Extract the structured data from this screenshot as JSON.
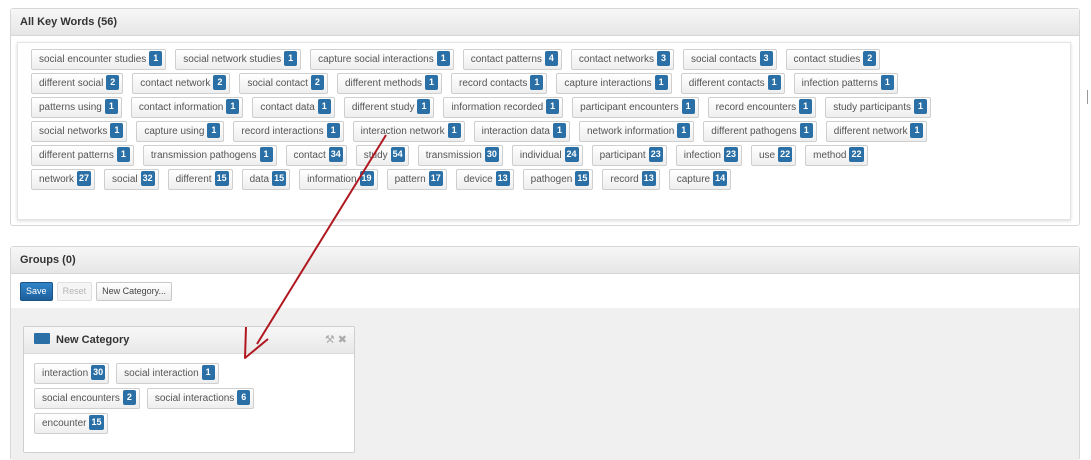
{
  "keywords_panel": {
    "title": "All Key Words (56)",
    "rows": [
      [
        {
          "label": "social encounter studies",
          "count": "1"
        },
        {
          "label": "social network studies",
          "count": "1"
        },
        {
          "label": "capture social interactions",
          "count": "1"
        },
        {
          "label": "contact patterns",
          "count": "4"
        },
        {
          "label": "contact networks",
          "count": "3"
        },
        {
          "label": "social contacts",
          "count": "3"
        },
        {
          "label": "contact studies",
          "count": "2"
        }
      ],
      [
        {
          "label": "different social",
          "count": "2"
        },
        {
          "label": "contact network",
          "count": "2"
        },
        {
          "label": "social contact",
          "count": "2"
        },
        {
          "label": "different methods",
          "count": "1"
        },
        {
          "label": "record contacts",
          "count": "1"
        },
        {
          "label": "capture interactions",
          "count": "1"
        },
        {
          "label": "different contacts",
          "count": "1"
        },
        {
          "label": "infection patterns",
          "count": "1"
        }
      ],
      [
        {
          "label": "patterns using",
          "count": "1"
        },
        {
          "label": "contact information",
          "count": "1"
        },
        {
          "label": "contact data",
          "count": "1"
        },
        {
          "label": "different study",
          "count": "1"
        },
        {
          "label": "information recorded",
          "count": "1"
        },
        {
          "label": "participant encounters",
          "count": "1"
        },
        {
          "label": "record encounters",
          "count": "1"
        },
        {
          "label": "study participants",
          "count": "1"
        }
      ],
      [
        {
          "label": "social networks",
          "count": "1"
        },
        {
          "label": "capture using",
          "count": "1"
        },
        {
          "label": "record interactions",
          "count": "1"
        },
        {
          "label": "interaction network",
          "count": "1"
        },
        {
          "label": "interaction data",
          "count": "1"
        },
        {
          "label": "network information",
          "count": "1"
        },
        {
          "label": "different pathogens",
          "count": "1"
        },
        {
          "label": "different network",
          "count": "1"
        }
      ],
      [
        {
          "label": "different patterns",
          "count": "1"
        },
        {
          "label": "transmission pathogens",
          "count": "1"
        },
        {
          "label": "contact",
          "count": "34"
        },
        {
          "label": "study",
          "count": "54"
        },
        {
          "label": "transmission",
          "count": "30"
        },
        {
          "label": "individual",
          "count": "24"
        },
        {
          "label": "participant",
          "count": "23"
        },
        {
          "label": "infection",
          "count": "23"
        },
        {
          "label": "use",
          "count": "22"
        },
        {
          "label": "method",
          "count": "22"
        }
      ],
      [
        {
          "label": "network",
          "count": "27"
        },
        {
          "label": "social",
          "count": "32"
        },
        {
          "label": "different",
          "count": "15"
        },
        {
          "label": "data",
          "count": "15"
        },
        {
          "label": "information",
          "count": "19"
        },
        {
          "label": "pattern",
          "count": "17"
        },
        {
          "label": "device",
          "count": "13"
        },
        {
          "label": "pathogen",
          "count": "15"
        },
        {
          "label": "record",
          "count": "13"
        },
        {
          "label": "capture",
          "count": "14"
        }
      ]
    ]
  },
  "groups_panel": {
    "title": "Groups (0)",
    "toolbar": {
      "save_label": "Save",
      "reset_label": "Reset",
      "new_category_label": "New Category..."
    },
    "category": {
      "title": "New Category",
      "tool_icons": [
        "wrench-icon",
        "close-icon"
      ],
      "rows": [
        [
          {
            "label": "interaction",
            "count": "30"
          },
          {
            "label": "social interaction",
            "count": "1"
          }
        ],
        [
          {
            "label": "social encounters",
            "count": "2"
          },
          {
            "label": "social interactions",
            "count": "6"
          }
        ],
        [
          {
            "label": "encounter",
            "count": "15"
          }
        ]
      ]
    }
  },
  "colors": {
    "badge": "#2a6fa5",
    "primary_button": "#1d5f9c",
    "annotation_arrow": "#b0171f"
  }
}
